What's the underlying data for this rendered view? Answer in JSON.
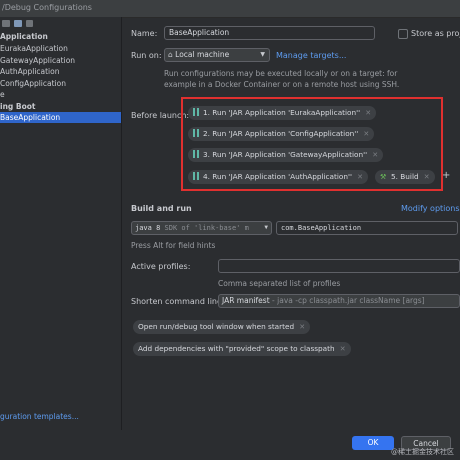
{
  "window": {
    "title": "/Debug Configurations"
  },
  "sidebar": {
    "items": [
      {
        "label": "Application",
        "bold": true
      },
      {
        "label": "EurakaApplication"
      },
      {
        "label": "GatewayApplication"
      },
      {
        "label": "AuthApplication"
      },
      {
        "label": "ConfigApplication"
      },
      {
        "label": "e"
      },
      {
        "label": "ing Boot",
        "bold": true
      },
      {
        "label": "BaseApplication",
        "selected": true
      }
    ],
    "footer_link": "guration templates..."
  },
  "form": {
    "name_label": "Name:",
    "name_value": "BaseApplication",
    "store_label": "Store as project",
    "run_on_label": "Run on:",
    "run_on_value": "Local machine",
    "manage_targets": "Manage targets...",
    "run_on_hint_1": "Run configurations may be executed locally or on a target: for",
    "run_on_hint_2": "example in a Docker Container or on a remote host using SSH.",
    "before_launch_label": "Before launch:",
    "tasks": [
      "1. Run 'JAR Application 'EurakaApplication''",
      "2. Run 'JAR Application 'ConfigApplication''",
      "3. Run 'JAR Application 'GatewayApplication''",
      "4. Run 'JAR Application 'AuthApplication''"
    ],
    "build_task": "5. Build",
    "add_task": "+",
    "build_and_run_label": "Build and run",
    "modify_options": "Modify options",
    "jdk_value": "java 8",
    "jdk_detail": "SDK of 'link-base' m",
    "main_class": "com.BaseApplication",
    "alt_hint": "Press Alt for field hints",
    "active_profiles_label": "Active profiles:",
    "profiles_hint": "Comma separated list of profiles",
    "shorten_label": "Shorten command line:",
    "shorten_value": "JAR manifest",
    "shorten_detail": "- java -cp classpath.jar className [args]",
    "option_chip_1": "Open run/debug tool window when started",
    "option_chip_2": "Add dependencies with \"provided\" scope to classpath"
  },
  "buttons": {
    "ok": "OK",
    "cancel": "Cancel"
  },
  "watermark": "@稀土掘金技术社区",
  "colors": {
    "accent": "#2f65ca",
    "link": "#5e9cf0",
    "highlight_box": "#e0302f"
  }
}
